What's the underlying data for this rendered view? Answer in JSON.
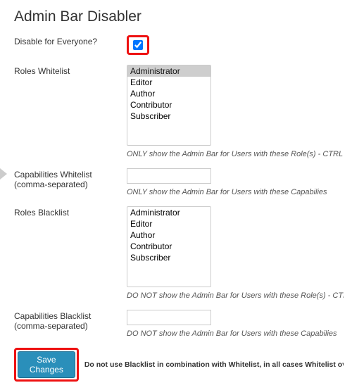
{
  "page": {
    "title": "Admin Bar Disabler"
  },
  "fields": {
    "disable_everyone": {
      "label": "Disable for Everyone?",
      "checked": true
    },
    "roles_whitelist": {
      "label": "Roles Whitelist",
      "options": [
        "Administrator",
        "Editor",
        "Author",
        "Contributor",
        "Subscriber"
      ],
      "selected": [
        "Administrator"
      ],
      "help": "ONLY show the Admin Bar for Users with these Role(s) - CTRL + Click for multiple selections"
    },
    "caps_whitelist": {
      "label": "Capabilities Whitelist (comma-separated)",
      "value": "",
      "help": "ONLY show the Admin Bar for Users with these Capabilies"
    },
    "roles_blacklist": {
      "label": "Roles Blacklist",
      "options": [
        "Administrator",
        "Editor",
        "Author",
        "Contributor",
        "Subscriber"
      ],
      "selected": [],
      "help": "DO NOT show the Admin Bar for Users with these Role(s) - CTRL + Click for multiple selections"
    },
    "caps_blacklist": {
      "label": "Capabilities Blacklist (comma-separated)",
      "value": "",
      "help": "DO NOT show the Admin Bar for Users with these Capabilies"
    }
  },
  "submit": {
    "button": "Save Changes",
    "note": "Do not use Blacklist in combination with Whitelist, in all cases Whitelist overrides Blacklist"
  }
}
